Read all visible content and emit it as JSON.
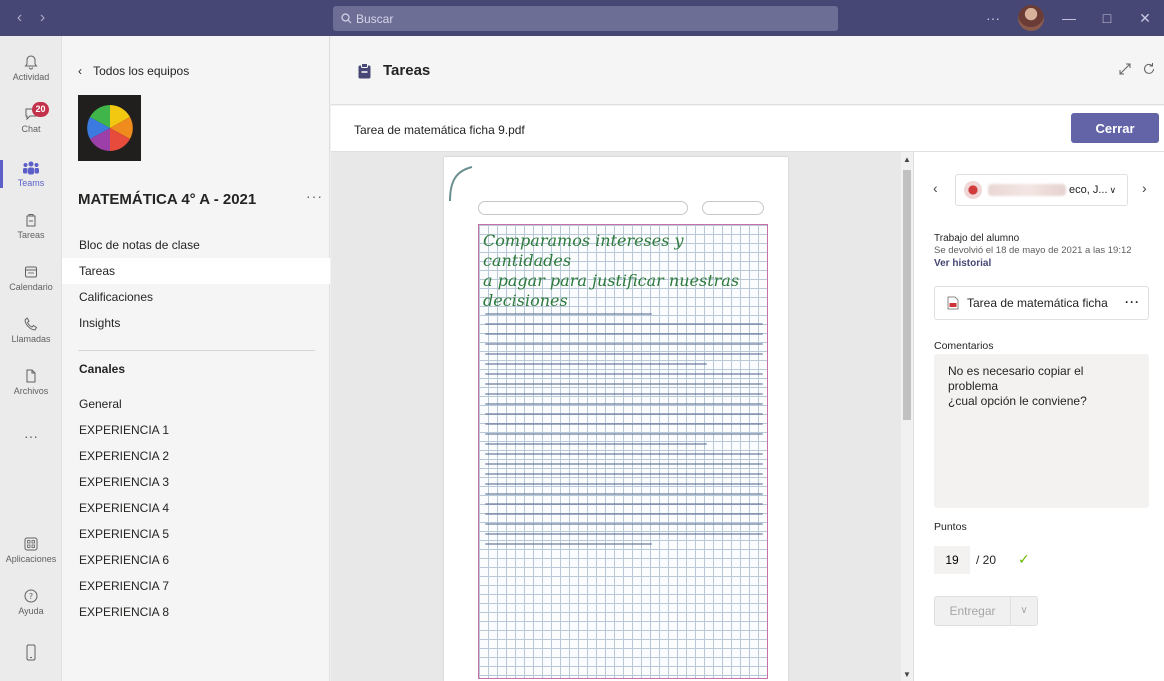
{
  "titlebar": {
    "search_placeholder": "Buscar",
    "more": "···"
  },
  "rail": {
    "items": [
      {
        "label": "Actividad",
        "icon": "bell-icon"
      },
      {
        "label": "Chat",
        "icon": "chat-icon",
        "badge": "20"
      },
      {
        "label": "Teams",
        "icon": "teams-icon"
      },
      {
        "label": "Tareas",
        "icon": "assignments-icon"
      },
      {
        "label": "Calendario",
        "icon": "calendar-icon"
      },
      {
        "label": "Llamadas",
        "icon": "phone-icon"
      },
      {
        "label": "Archivos",
        "icon": "file-icon"
      },
      {
        "label": "···",
        "icon": "more-icon"
      },
      {
        "label": "Aplicaciones",
        "icon": "apps-icon"
      },
      {
        "label": "Ayuda",
        "icon": "help-icon"
      }
    ]
  },
  "team": {
    "back_label": "Todos los equipos",
    "name": "MATEMÁTICA 4° A - 2021",
    "more": "···",
    "nav": [
      "Bloc de notas de clase",
      "Tareas",
      "Calificaciones",
      "Insights"
    ],
    "channels_heading": "Canales",
    "channels": [
      "General",
      "EXPERIENCIA 1",
      "EXPERIENCIA 2",
      "EXPERIENCIA 3",
      "EXPERIENCIA 4",
      "EXPERIENCIA 5",
      "EXPERIENCIA 6",
      "EXPERIENCIA 7",
      "EXPERIENCIA 8"
    ]
  },
  "main": {
    "title": "Tareas"
  },
  "document": {
    "filename": "Tarea de matemática ficha 9.pdf",
    "close_label": "Cerrar",
    "heading_lines": [
      "Comparamos intereses y cantidades",
      "a pagar para justificar nuestras",
      "decisiones"
    ]
  },
  "grading": {
    "student_name_suffix": "eco, J...",
    "work_heading": "Trabajo del alumno",
    "returned_text": "Se devolvió el 18 de mayo de 2021 a las 19:12",
    "history_link": "Ver historial",
    "file_label": "Tarea de matemática ficha",
    "file_more": "···",
    "comments_heading": "Comentarios",
    "comment_text": "No es necesario copiar el\nproblema\n¿cual opción le conviene?",
    "points_heading": "Puntos",
    "points_value": "19",
    "points_max": "/ 20",
    "submit_label": "Entregar"
  },
  "colors": {
    "titlebar": "#464775",
    "accent": "#6264a7",
    "active_rail": "#5b5fc7",
    "badge": "#c4314b",
    "check": "#6bb700"
  }
}
